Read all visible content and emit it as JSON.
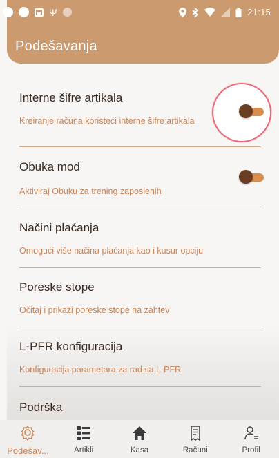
{
  "status_bar": {
    "time": "21:15",
    "icons_left": [
      "whatsapp-icon",
      "chat-icon",
      "gallery-icon",
      "usb-icon",
      "circle-icon"
    ],
    "icons_right": [
      "location-icon",
      "bluetooth-icon",
      "wifi-icon",
      "signal-icon",
      "battery-icon"
    ]
  },
  "header": {
    "title": "Podešavanja"
  },
  "settings": [
    {
      "title": "Interne šifre artikala",
      "subtitle": "Kreiranje računa koristeći interne šifre artikala",
      "toggle": true,
      "toggle_on": true
    },
    {
      "title": "Obuka mod",
      "subtitle": "Aktiviraj Obuku za trening zaposlenih",
      "toggle": true,
      "toggle_on": true
    },
    {
      "title": "Načini plaćanja",
      "subtitle": "Omogući više načina plaćanja kao i kusur opciju",
      "toggle": false
    },
    {
      "title": "Poreske stope",
      "subtitle": "Očitaj i prikaži poreske stope na zahtev",
      "toggle": false
    },
    {
      "title": "L-PFR konfiguracija",
      "subtitle": "Konfiguracija parametara za rad sa L-PFR",
      "toggle": false
    },
    {
      "title": "Podrška",
      "subtitle": "",
      "toggle": false
    }
  ],
  "bottom_nav": [
    {
      "label": "Podešav...",
      "icon": "settings-icon",
      "active": true
    },
    {
      "label": "Artikli",
      "icon": "list-icon",
      "active": false
    },
    {
      "label": "Kasa",
      "icon": "home-icon",
      "active": false
    },
    {
      "label": "Računi",
      "icon": "receipt-icon",
      "active": false
    },
    {
      "label": "Profil",
      "icon": "profile-icon",
      "active": false
    }
  ],
  "colors": {
    "header": "#cc9a6f",
    "accent": "#c8855a",
    "toggle_track": "#d98d4e",
    "toggle_knob": "#6a3d22",
    "focus_ring": "#e86a7a"
  }
}
